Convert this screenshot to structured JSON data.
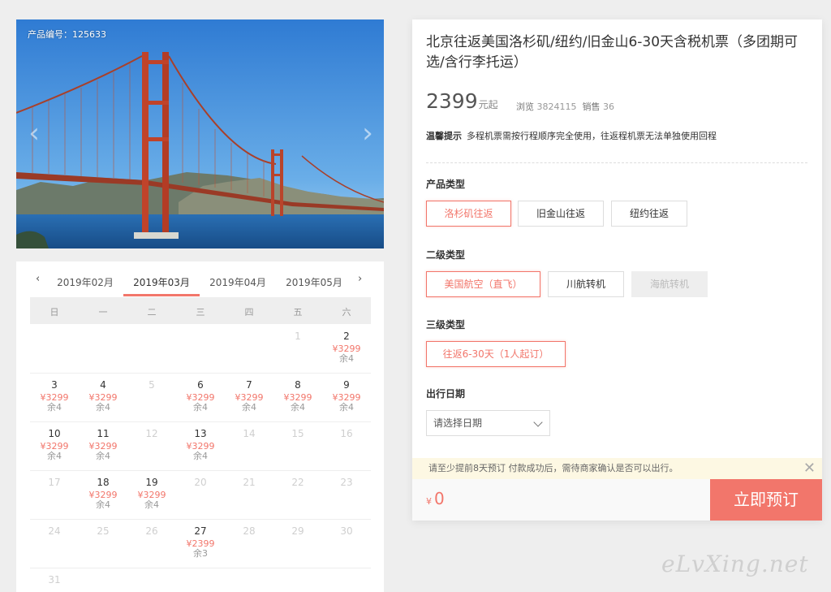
{
  "hero": {
    "product_code": "产品编号：125633",
    "prev_glyph": "‹",
    "next_glyph": "›",
    "image_subject": "golden-gate-bridge"
  },
  "calendar": {
    "prev": "‹",
    "next": "›",
    "months": [
      "2019年02月",
      "2019年03月",
      "2019年04月",
      "2019年05月"
    ],
    "active_month": "2019年03月",
    "weekdays": [
      "日",
      "一",
      "二",
      "三",
      "四",
      "五",
      "六"
    ],
    "weeks": [
      [
        null,
        null,
        null,
        null,
        null,
        {
          "d": "1",
          "dis": true
        },
        {
          "d": "2",
          "p": "¥3299",
          "r": "余4"
        }
      ],
      [
        {
          "d": "3",
          "p": "¥3299",
          "r": "余4"
        },
        {
          "d": "4",
          "p": "¥3299",
          "r": "余4"
        },
        {
          "d": "5",
          "dis": true
        },
        {
          "d": "6",
          "p": "¥3299",
          "r": "余4"
        },
        {
          "d": "7",
          "p": "¥3299",
          "r": "余4"
        },
        {
          "d": "8",
          "p": "¥3299",
          "r": "余4"
        },
        {
          "d": "9",
          "p": "¥3299",
          "r": "余4"
        }
      ],
      [
        {
          "d": "10",
          "p": "¥3299",
          "r": "余4"
        },
        {
          "d": "11",
          "p": "¥3299",
          "r": "余4"
        },
        {
          "d": "12",
          "dis": true
        },
        {
          "d": "13",
          "p": "¥3299",
          "r": "余4"
        },
        {
          "d": "14",
          "dis": true
        },
        {
          "d": "15",
          "dis": true
        },
        {
          "d": "16",
          "dis": true
        }
      ],
      [
        {
          "d": "17",
          "dis": true
        },
        {
          "d": "18",
          "p": "¥3299",
          "r": "余4"
        },
        {
          "d": "19",
          "p": "¥3299",
          "r": "余4"
        },
        {
          "d": "20",
          "dis": true
        },
        {
          "d": "21",
          "dis": true
        },
        {
          "d": "22",
          "dis": true
        },
        {
          "d": "23",
          "dis": true
        }
      ],
      [
        {
          "d": "24",
          "dis": true
        },
        {
          "d": "25",
          "dis": true
        },
        {
          "d": "26",
          "dis": true
        },
        {
          "d": "27",
          "p": "¥2399",
          "r": "余3"
        },
        {
          "d": "28",
          "dis": true
        },
        {
          "d": "29",
          "dis": true
        },
        {
          "d": "30",
          "dis": true
        }
      ],
      [
        {
          "d": "31",
          "dis": true
        },
        null,
        null,
        null,
        null,
        null,
        null
      ]
    ]
  },
  "product": {
    "title": "北京往返美国洛杉矶/纽约/旧金山6-30天含税机票（多团期可选/含行李托运）",
    "price": "2399",
    "price_unit": "元起",
    "views_label": "浏览",
    "views": "3824115",
    "sales_label": "销售",
    "sales": "36",
    "tip_label": "温馨提示",
    "tip_text": "多程机票需按行程顺序完全使用，往返程机票无法单独使用回程",
    "type_label": "产品类型",
    "types": [
      "洛杉矶往返",
      "旧金山往返",
      "纽约往返"
    ],
    "sub_label": "二级类型",
    "subs": [
      "美国航空（直飞）",
      "川航转机",
      "海航转机"
    ],
    "third_label": "三级类型",
    "thirds": [
      "往返6-30天（1人起订）"
    ],
    "date_label": "出行日期",
    "date_placeholder": "请选择日期",
    "notice": "请至少提前8天预订 付款成功后，需待商家确认是否可以出行。",
    "notice_close": "✕",
    "currency": "¥",
    "total": "0",
    "book_label": "立即预订",
    "accent_color": "#f2766b"
  },
  "watermark": "eLvXing.net"
}
